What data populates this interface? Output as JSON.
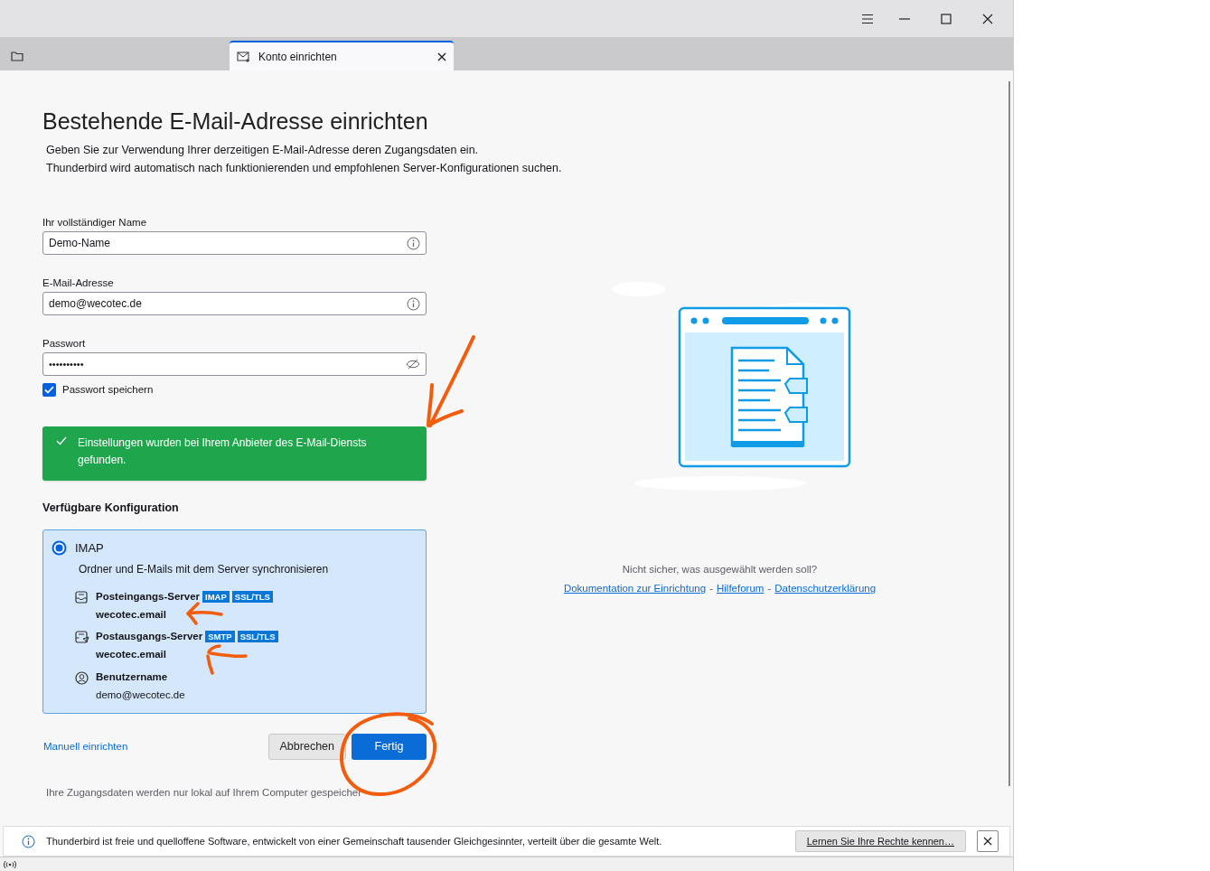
{
  "tabs": [
    {
      "kind": "folder",
      "selected": false
    },
    {
      "kind": "page",
      "label": "Konto einrichten",
      "selected": true
    }
  ],
  "heading": "Bestehende E-Mail-Adresse einrichten",
  "intro": [
    "Geben Sie zur Verwendung Ihrer derzeitigen E-Mail-Adresse deren Zugangsdaten ein.",
    "Thunderbird wird automatisch nach funktionierenden und empfohlenen Server-Konfigurationen suchen."
  ],
  "fields": [
    {
      "kind": "text",
      "label": "Ihr vollständiger Name",
      "value": "Demo-Name"
    },
    {
      "kind": "text",
      "label": "E-Mail-Adresse",
      "value": "demo@wecotec.de"
    },
    {
      "kind": "password",
      "label": "Passwort",
      "value": "••••••••••"
    }
  ],
  "remember_password": {
    "label": "Passwort speichern",
    "checked": true
  },
  "success_message": "Einstellungen wurden bei Ihrem Anbieter des E-Mail-Diensts gefunden.",
  "config": {
    "heading": "Verfügbare Konfiguration",
    "options": [
      {
        "label": "IMAP",
        "selected": true,
        "description": "Ordner und E-Mails mit dem Server synchronisieren",
        "entries": [
          {
            "kind": "incoming",
            "label": "Posteingangs-Server",
            "tags": [
              "IMAP",
              "SSL/TLS"
            ],
            "value": "wecotec.email"
          },
          {
            "kind": "outgoing",
            "label": "Postausgangs-Server",
            "tags": [
              "SMTP",
              "SSL/TLS"
            ],
            "value": "wecotec.email"
          },
          {
            "kind": "user",
            "label": "Benutzername",
            "value": "demo@wecotec.de"
          }
        ]
      }
    ]
  },
  "manual_link": "Manuell einrichten",
  "buttons": [
    {
      "kind": "secondary",
      "label": "Abbrechen"
    },
    {
      "kind": "primary",
      "label": "Fertig"
    }
  ],
  "footnote": "Ihre Zugangsdaten werden nur lokal auf Ihrem Computer gespeicher",
  "help": {
    "question": "Nicht sicher, was ausgewählt werden soll?",
    "items": [
      {
        "kind": "link",
        "text": "Dokumentation zur Einrichtung"
      },
      {
        "kind": "separator",
        "text": "-"
      },
      {
        "kind": "link",
        "text": "Hilfeforum"
      },
      {
        "kind": "separator",
        "text": "-"
      },
      {
        "kind": "link",
        "text": "Datenschutzerklärung"
      }
    ]
  },
  "notification": {
    "text": "Thunderbird ist freie und quelloffene Software, entwickelt von einer Gemeinschaft tausender Gleichgesinnter, verteilt über die gesamte Welt.",
    "button": "Lernen Sie Ihre Rechte kennen…"
  },
  "annotations": [
    {
      "kind": "arrow"
    },
    {
      "kind": "arrow"
    },
    {
      "kind": "arrow"
    },
    {
      "kind": "circle"
    }
  ]
}
